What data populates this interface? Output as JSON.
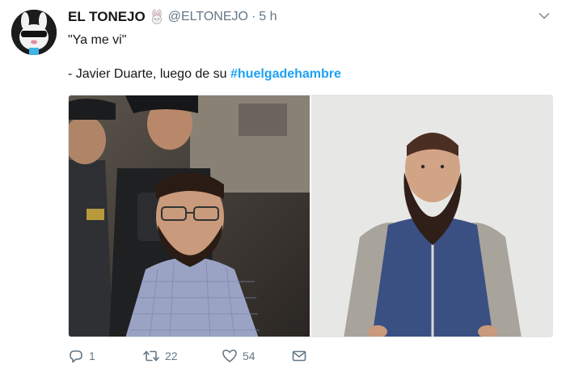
{
  "tweet": {
    "display_name": "EL TONEJO",
    "name_emoji_icon": "rabbit-face-icon",
    "handle": "@ELTONEJO",
    "separator": "·",
    "time": "5 h",
    "line1": "\"Ya me vi\"",
    "line2_prefix": "- Javier Duarte, luego de su ",
    "hashtag": "#huelgadehambre",
    "media": {
      "left_photo": "photo-man-with-beard-escorted-by-guards",
      "right_photo": "photo-bearded-man-in-blue-vest"
    },
    "actions": {
      "reply_count": "1",
      "retweet_count": "22",
      "like_count": "54"
    },
    "colors": {
      "link": "#1da1f2",
      "muted": "#657786",
      "text": "#14171a"
    }
  }
}
